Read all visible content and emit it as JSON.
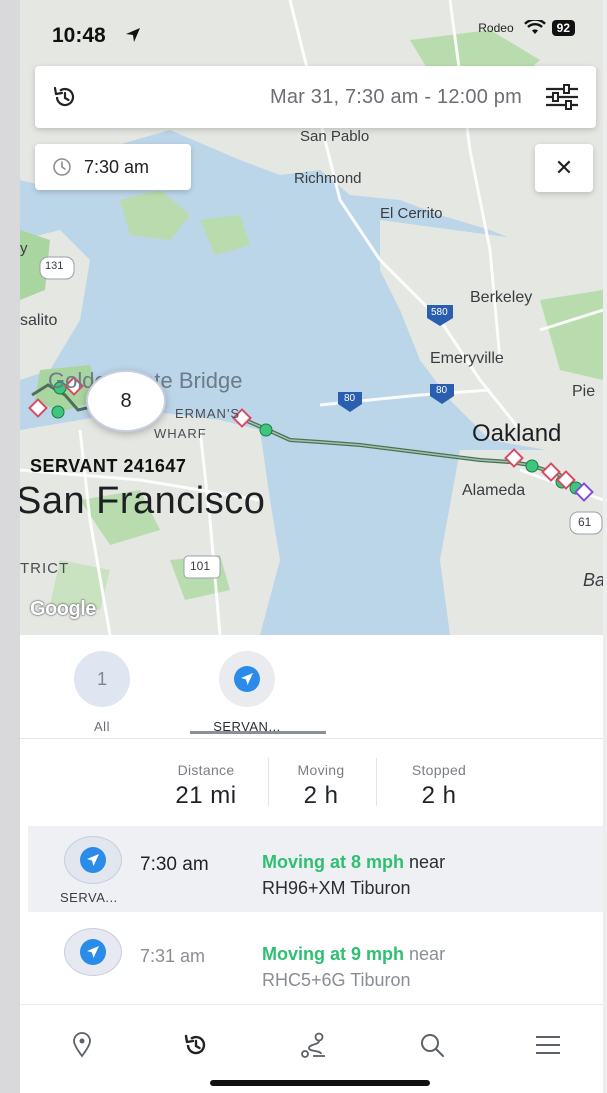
{
  "status_bar": {
    "time": "10:48",
    "carrier": "Rodeo",
    "battery": "92"
  },
  "filter_bar": {
    "date_range": "Mar 31, 7:30 am - 12:00 pm"
  },
  "time_chip": {
    "label": "7:30 am"
  },
  "close_button": {
    "label": "✕"
  },
  "map": {
    "labels": {
      "san_pablo": "San Pablo",
      "richmond": "Richmond",
      "el_cerrito": "El Cerrito",
      "berkeley": "Berkeley",
      "emeryville": "Emeryville",
      "oakland": "Oakland",
      "alameda": "Alameda",
      "piedmont": "Pie",
      "sausalito": "salito",
      "golden_gate": "Golden Gate Bridge",
      "fishermans_wharf_1": "ERMAN'S",
      "fishermans_wharf_2": "WHARF",
      "vehicle": "SERVANT 241647",
      "san_francisco": "San Francisco",
      "district": "TRICT",
      "ba": "Ba",
      "r131": "131",
      "r580": "580",
      "r80a": "80",
      "r80b": "80",
      "r101": "101",
      "r61": "61",
      "y_partial": "y"
    },
    "cluster_count": "8",
    "attribution": "Google"
  },
  "tabs": [
    {
      "badge": "1",
      "label": "All"
    },
    {
      "label": "SERVAN..."
    }
  ],
  "stats": [
    {
      "label": "Distance",
      "value": "21 mi"
    },
    {
      "label": "Moving",
      "value": "2 h"
    },
    {
      "label": "Stopped",
      "value": "2 h"
    }
  ],
  "events": [
    {
      "vehicle_label": "SERVA...",
      "time": "7:30 am",
      "status": "Moving at 8 mph",
      "near_text": "near",
      "location": "RH96+XM Tiburon"
    },
    {
      "time": "7:31 am",
      "status": "Moving at 9 mph",
      "near_text": "near",
      "location": "RHC5+6G Tiburon"
    }
  ],
  "colors": {
    "moving_green": "#2fbf71",
    "route": "#4f6f57",
    "water": "#bcd6e9",
    "land": "#e4e6e3",
    "vehicle_blue": "#2a8be8"
  },
  "nav": [
    "location-pin-icon",
    "history-icon",
    "route-icon",
    "search-icon",
    "menu-icon"
  ]
}
